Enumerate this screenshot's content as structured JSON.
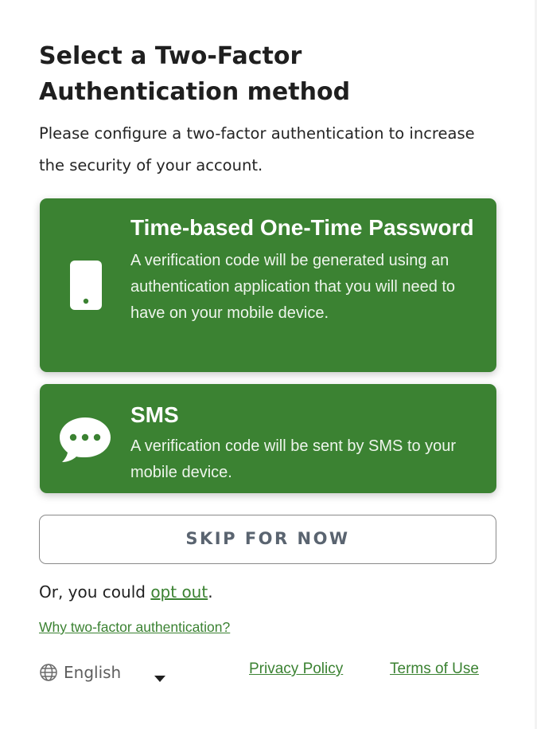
{
  "page": {
    "title": "Select a Two-Factor Authentication method",
    "subtitle": "Please configure a two-factor authentication to increase the security of your account."
  },
  "methods": [
    {
      "icon": "mobile-phone-icon",
      "title": "Time-based One-Time Password",
      "description": "A verification code will be generated using an authentication application that you will need to have on your mobile device."
    },
    {
      "icon": "chat-bubble-icon",
      "title": "SMS",
      "description": "A verification code will be sent by SMS to your mobile device."
    }
  ],
  "skip_label": "SKIP FOR NOW",
  "optout": {
    "prefix": "Or, you could ",
    "link": "opt out",
    "suffix": "."
  },
  "why_link": "Why two-factor authentication?",
  "footer": {
    "language": "English",
    "language_icon": "globe-icon",
    "privacy": "Privacy Policy",
    "terms": "Terms of Use"
  },
  "colors": {
    "accent": "#3b8232",
    "card_background": "#3b8232",
    "page_background": "#ffffff",
    "button_border": "#8a8a8a",
    "button_text": "#5a6470"
  }
}
